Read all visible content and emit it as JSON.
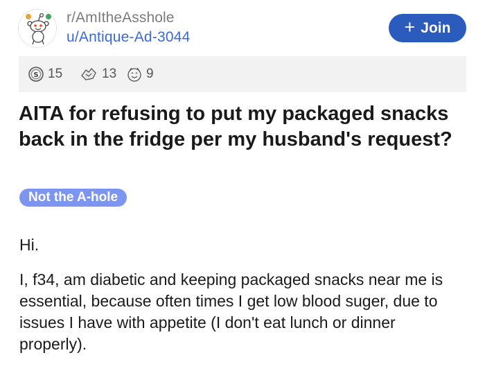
{
  "post_header": {
    "subreddit": "r/AmItheAsshole",
    "username": "u/Antique-Ad-3044",
    "avatar_icon": "snoo-avatar-icon",
    "join_label": "Join",
    "join_icon": "plus-icon",
    "join_color": "#2b5bbd"
  },
  "awards": [
    {
      "icon": "silver-award-icon",
      "count": "15"
    },
    {
      "icon": "helpful-award-icon",
      "count": "13"
    },
    {
      "icon": "wholesome-award-icon",
      "count": "9"
    }
  ],
  "post": {
    "title": "AITA for refusing to put my packaged snacks back in the fridge per my husband's request?",
    "flair": "Not the A-hole",
    "flair_color": "#7b95f0",
    "paragraphs": [
      "Hi.",
      "I, f34, am diabetic and keeping packaged snacks near me is essential, because often times I get low blood suger, due to issues I have with appetite (I don't eat lunch or dinner properly)."
    ]
  }
}
